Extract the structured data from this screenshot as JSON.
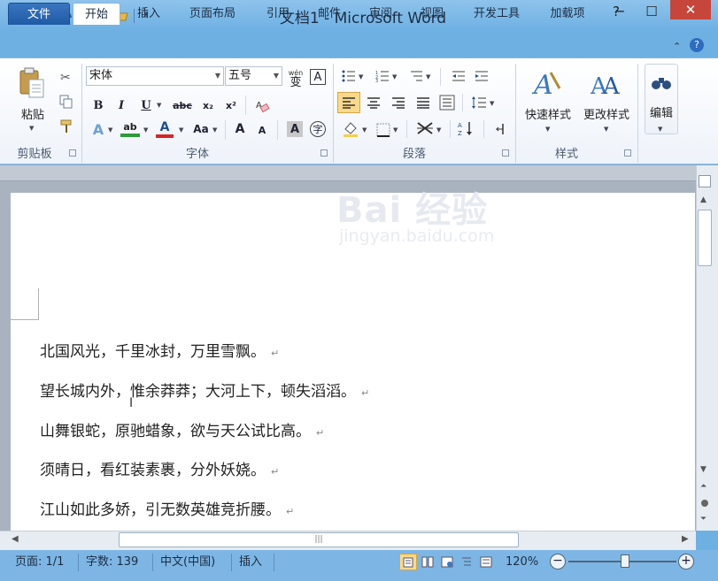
{
  "window": {
    "title": "文档1 - Microsoft Word",
    "app_icon": "W",
    "controls": {
      "help": "?",
      "minimize": "─",
      "maximize": "☐",
      "close": "✕"
    }
  },
  "quick_access": {
    "save_icon": "save-icon",
    "undo_icon": "undo-icon",
    "redo_icon": "redo-icon",
    "open_icon": "open-icon",
    "customize_icon": "customize-icon"
  },
  "tabs": [
    {
      "label": "文件"
    },
    {
      "label": "开始"
    },
    {
      "label": "插入"
    },
    {
      "label": "页面布局"
    },
    {
      "label": "引用"
    },
    {
      "label": "邮件"
    },
    {
      "label": "审阅"
    },
    {
      "label": "视图"
    },
    {
      "label": "开发工具"
    },
    {
      "label": "加载项"
    }
  ],
  "ribbon": {
    "clipboard": {
      "group_label": "剪贴板",
      "paste_label": "粘贴"
    },
    "font": {
      "group_label": "字体",
      "font_name": "宋体",
      "font_size": "五号",
      "wen_label": "wén",
      "wen_char": "变",
      "border_char": "A",
      "bold": "B",
      "italic": "I",
      "underline": "U",
      "strike": "abc",
      "subscript": "x₂",
      "superscript": "x²",
      "text_effect": "A",
      "highlight": "ab",
      "font_color": "A",
      "change_case": "Aa",
      "grow": "A",
      "shrink": "A",
      "char_shading": "A",
      "enclose": "字"
    },
    "paragraph": {
      "group_label": "段落"
    },
    "styles": {
      "group_label": "样式",
      "quick_styles_label": "快速样式",
      "change_styles_label": "更改样式"
    },
    "editing": {
      "label": "编辑"
    }
  },
  "colors": {
    "highlight": "#2e9b3a",
    "font_color": "#d42727"
  },
  "document": {
    "lines": [
      "北国风光，千里冰封，万里雪飘。",
      "望长城内外，惟余莽莽；大河上下，顿失滔滔。",
      "山舞银蛇，原驰蜡象，欲与天公试比高。",
      "须晴日，看红装素裹，分外妖娆。",
      "江山如此多娇，引无数英雄竞折腰。"
    ],
    "paragraph_mark": "↵",
    "watermark_main": "Bai 经验",
    "watermark_sub": "jingyan.baidu.com"
  },
  "status": {
    "page": "页面: 1/1",
    "words": "字数: 139",
    "language": "中文(中国)",
    "mode": "插入",
    "zoom": "120%"
  }
}
